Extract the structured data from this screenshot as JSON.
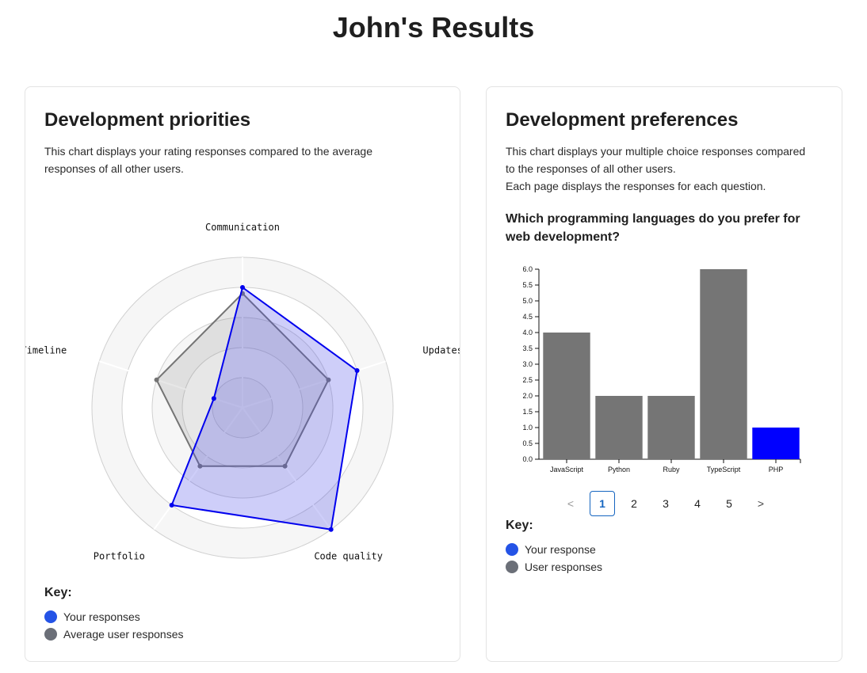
{
  "page": {
    "title": "John's Results"
  },
  "priorities": {
    "title": "Development priorities",
    "description": [
      "This chart displays your rating responses compared to the average",
      "responses of all other users."
    ],
    "key_title": "Key:",
    "key": [
      {
        "label": "Your responses",
        "color": "#2453e6"
      },
      {
        "label": "Average user responses",
        "color": "#6b6f78"
      }
    ]
  },
  "preferences": {
    "title": "Development preferences",
    "description": [
      "This chart displays your multiple choice responses compared",
      "to the responses of all other users.",
      "Each page displays the responses for each question."
    ],
    "question": "Which programming languages do you prefer for web development?",
    "key_title": "Key:",
    "key": [
      {
        "label": "Your response",
        "color": "#2453e6"
      },
      {
        "label": "User responses",
        "color": "#6b6f78"
      }
    ],
    "pagination": {
      "prev_icon": "chevron-left-icon",
      "next_icon": "chevron-right-icon",
      "pages": [
        "1",
        "2",
        "3",
        "4",
        "5"
      ],
      "current": "1"
    }
  },
  "chart_data": [
    {
      "type": "radar",
      "axes": [
        "Communication",
        "Updates",
        "Code quality",
        "Portfolio",
        "Timeline"
      ],
      "range": [
        0,
        5
      ],
      "grid_levels": 5,
      "series": [
        {
          "name": "Your responses",
          "values": [
            4,
            4,
            5,
            4,
            1
          ],
          "color": "#0000ee",
          "fill": "rgba(80,80,235,0.28)"
        },
        {
          "name": "Average user responses",
          "values": [
            3.8,
            3,
            2.4,
            2.4,
            3
          ],
          "color": "#747474",
          "fill": "rgba(120,120,120,0.18)"
        }
      ]
    },
    {
      "type": "bar",
      "categories": [
        "JavaScript",
        "Python",
        "Ruby",
        "TypeScript",
        "PHP"
      ],
      "values": [
        4,
        2,
        2,
        6,
        1
      ],
      "highlight": "PHP",
      "highlight_color": "#0000ff",
      "bar_color": "#757575",
      "ylim": [
        0,
        6
      ],
      "yticks": [
        "0.0",
        "0.5",
        "1.0",
        "1.5",
        "2.0",
        "2.5",
        "3.0",
        "3.5",
        "4.0",
        "4.5",
        "5.0",
        "5.5",
        "6.0"
      ]
    }
  ]
}
